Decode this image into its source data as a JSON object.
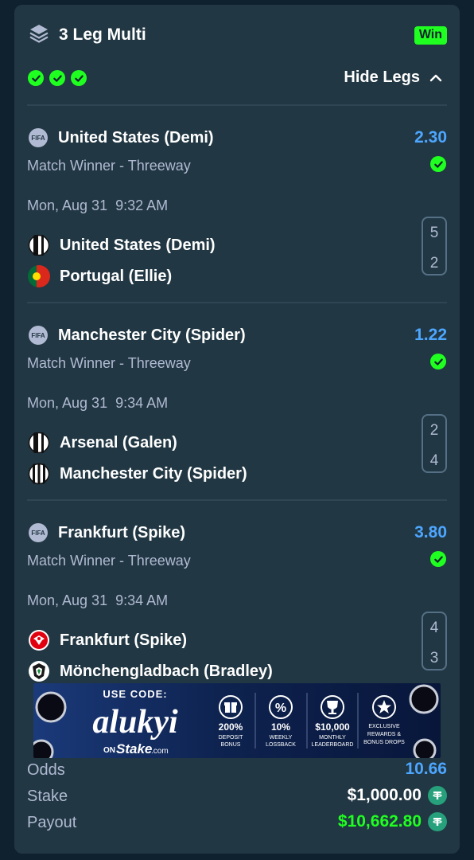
{
  "bet": {
    "title": "3 Leg Multi",
    "status": "Win",
    "hide_legs_label": "Hide Legs",
    "colors": {
      "accent_blue": "#4da6ff",
      "win_green": "#1fff20",
      "payout_green": "#1fff20"
    }
  },
  "legs": [
    {
      "icon": "fifa-icon",
      "title": "United States (Demi)",
      "odds": "2.30",
      "market": "Match Winner - Threeway",
      "date": "Mon, Aug 31",
      "time": "9:32 AM",
      "teams": [
        {
          "name": "United States (Demi)",
          "score": "5",
          "icon": "striped-shield-icon"
        },
        {
          "name": "Portugal (Ellie)",
          "score": "2",
          "icon": "portugal-flag-icon"
        }
      ]
    },
    {
      "icon": "fifa-icon",
      "title": "Manchester City (Spider)",
      "odds": "1.22",
      "market": "Match Winner - Threeway",
      "date": "Mon, Aug 31",
      "time": "9:34 AM",
      "teams": [
        {
          "name": "Arsenal (Galen)",
          "score": "2",
          "icon": "striped-shield-icon"
        },
        {
          "name": "Manchester City (Spider)",
          "score": "4",
          "icon": "striped-shield-icon"
        }
      ]
    },
    {
      "icon": "fifa-icon",
      "title": "Frankfurt (Spike)",
      "odds": "3.80",
      "market": "Match Winner - Threeway",
      "date": "Mon, Aug 31",
      "time": "9:34 AM",
      "teams": [
        {
          "name": "Frankfurt (Spike)",
          "score": "4",
          "icon": "frankfurt-crest-icon"
        },
        {
          "name": "Mönchengladbach (Bradley)",
          "score": "3",
          "icon": "gladbach-crest-icon"
        }
      ]
    }
  ],
  "banner": {
    "use_code_label": "USE CODE:",
    "code": "alukyi",
    "on_label": "ON",
    "brand": "Stake",
    "brand_suffix": ".com",
    "perks": [
      {
        "icon": "gift-icon",
        "title": "200%",
        "lines": [
          "DEPOSIT",
          "BONUS"
        ]
      },
      {
        "icon": "percent-icon",
        "title": "10%",
        "lines": [
          "WEEKLY",
          "LOSSBACK"
        ]
      },
      {
        "icon": "trophy-icon",
        "title": "$10,000",
        "lines": [
          "MONTHLY",
          "LEADERBOARD"
        ]
      },
      {
        "icon": "star-icon",
        "title": "",
        "lines": [
          "EXCLUSIVE",
          "REWARDS &",
          "BONUS DROPS"
        ]
      }
    ]
  },
  "summary": {
    "odds_label": "Odds",
    "odds_value": "10.66",
    "stake_label": "Stake",
    "stake_value": "$1,000.00",
    "payout_label": "Payout",
    "payout_value": "$10,662.80",
    "currency_icon": "tether-icon"
  }
}
